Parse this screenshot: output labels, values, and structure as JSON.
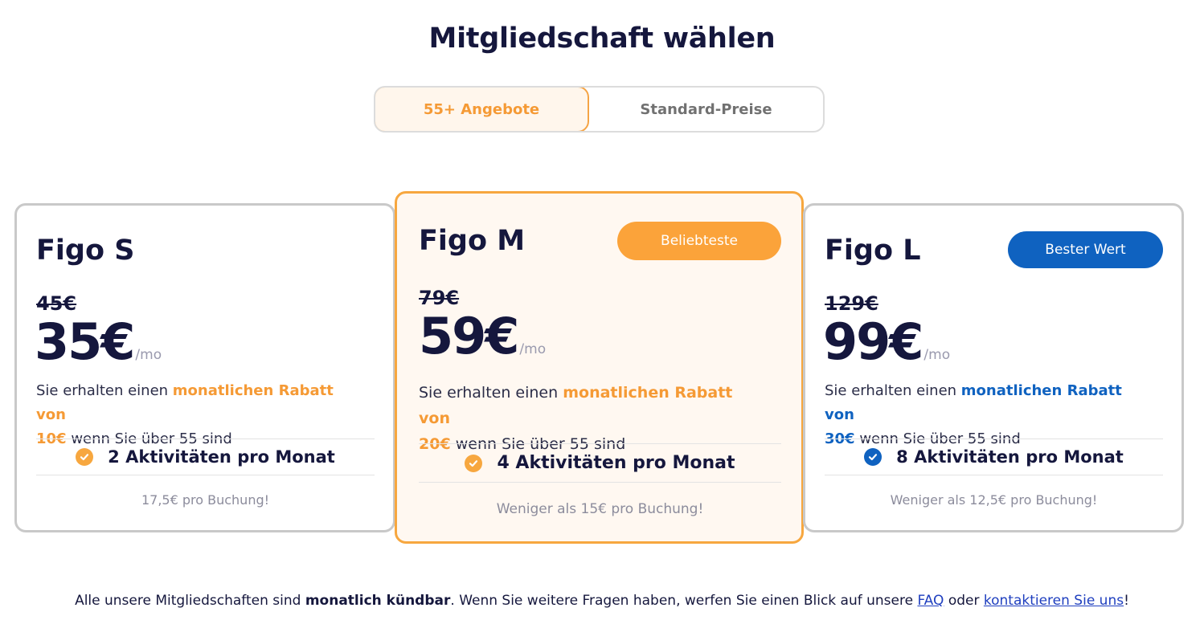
{
  "page": {
    "title": "Mitgliedschaft wählen"
  },
  "toggle": {
    "options": [
      {
        "label": "55+ Angebote",
        "active": true
      },
      {
        "label": "Standard-Preise",
        "active": false
      }
    ]
  },
  "plans": [
    {
      "name": "Figo S",
      "badge": "",
      "old_price": "45€",
      "price": "35€",
      "period": "/mo",
      "desc_prefix": "Sie erhalten einen",
      "desc_highlight1": "monatlichen Rabatt von",
      "desc_highlight2": "10€",
      "desc_suffix": "wenn Sie über 55 sind",
      "activities": "2 Aktivitäten pro Monat",
      "note": "17,5€ pro Buchung!"
    },
    {
      "name": "Figo M",
      "badge": "Beliebteste",
      "old_price": "79€",
      "price": "59€",
      "period": "/mo",
      "desc_prefix": "Sie erhalten einen",
      "desc_highlight1": "monatlichen Rabatt von",
      "desc_highlight2": "20€",
      "desc_suffix": "wenn Sie über 55 sind",
      "activities": "4 Aktivitäten pro Monat",
      "note": "Weniger als 15€ pro Buchung!"
    },
    {
      "name": "Figo L",
      "badge": "Bester Wert",
      "old_price": "129€",
      "price": "99€",
      "period": "/mo",
      "desc_prefix": "Sie erhalten einen",
      "desc_highlight1": "monatlichen Rabatt von",
      "desc_highlight2": "30€",
      "desc_suffix": "wenn Sie über 55 sind",
      "activities": "8 Aktivitäten pro Monat",
      "note": "Weniger als 12,5€ pro Buchung!"
    }
  ],
  "footer": {
    "text1": "Alle unsere Mitgliedschaften sind",
    "bold": "monatlich kündbar",
    "text2": ". Wenn Sie weitere Fragen haben, werfen Sie einen Blick auf unsere",
    "faq_link": "FAQ",
    "text3": "oder",
    "contact_link": "kontaktieren Sie uns",
    "text4": "!"
  },
  "colors": {
    "accent_orange": "#f7a73f",
    "accent_blue": "#0f62c0",
    "text_dark": "#15173d"
  },
  "icons": {
    "check": "check-circle-icon"
  }
}
